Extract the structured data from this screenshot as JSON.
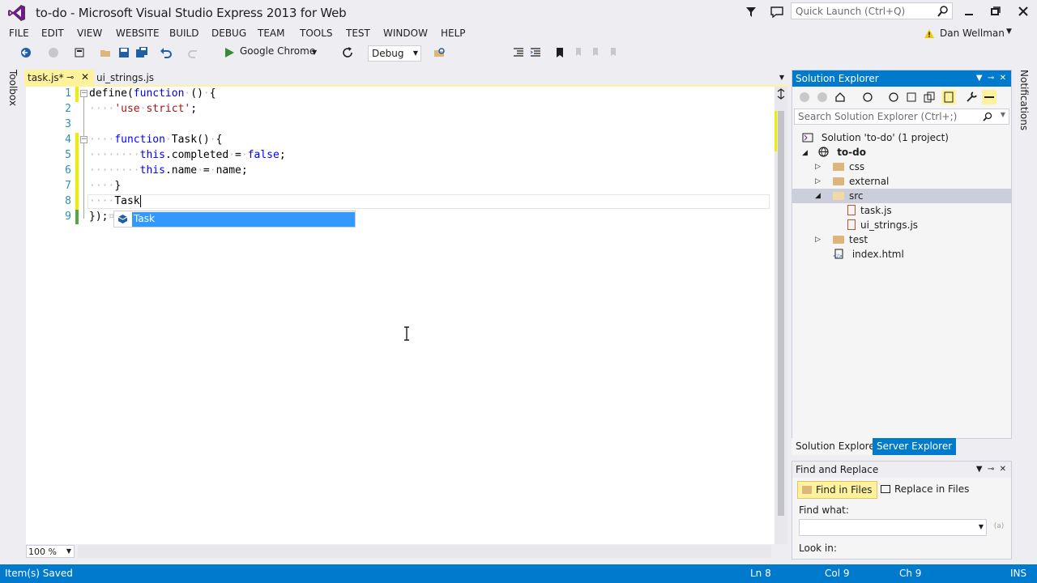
{
  "window": {
    "title": "to-do - Microsoft Visual Studio Express 2013 for Web",
    "quick_launch_placeholder": "Quick Launch (Ctrl+Q)",
    "user_name": "Dan Wellman"
  },
  "menu": [
    "FILE",
    "EDIT",
    "VIEW",
    "WEBSITE",
    "BUILD",
    "DEBUG",
    "TEAM",
    "TOOLS",
    "TEST",
    "WINDOW",
    "HELP"
  ],
  "toolbar": {
    "launch_target": "Google Chrome",
    "configuration": "Debug"
  },
  "side_strips": {
    "left": "Toolbox",
    "right": "Notifications"
  },
  "tabs": [
    {
      "label": "task.js*",
      "active": true
    },
    {
      "label": "ui_strings.js",
      "active": false
    }
  ],
  "editor": {
    "line_numbers": [
      "1",
      "2",
      "3",
      "4",
      "5",
      "6",
      "7",
      "8",
      "9"
    ],
    "completion_item": "Task",
    "zoom": "100 %"
  },
  "solution_explorer": {
    "title": "Solution Explorer",
    "search_placeholder": "Search Solution Explorer (Ctrl+;)",
    "tree": [
      {
        "label": "Solution 'to-do' (1 project)",
        "kind": "solution"
      },
      {
        "label": "to-do",
        "kind": "project"
      },
      {
        "label": "css",
        "kind": "folder"
      },
      {
        "label": "external",
        "kind": "folder"
      },
      {
        "label": "src",
        "kind": "folder",
        "selected": true
      },
      {
        "label": "task.js",
        "kind": "js-file"
      },
      {
        "label": "ui_strings.js",
        "kind": "js-file"
      },
      {
        "label": "test",
        "kind": "folder"
      },
      {
        "label": "index.html",
        "kind": "html-file"
      }
    ],
    "bottom_tabs": [
      "Solution Explorer",
      "Server Explorer"
    ]
  },
  "find_replace": {
    "title": "Find and Replace",
    "find_in_files": "Find in Files",
    "replace_in_files": "Replace in Files",
    "find_what_label": "Find what:",
    "look_in_label": "Look in:"
  },
  "status": {
    "message": "Item(s) Saved",
    "line": "Ln 8",
    "col": "Col 9",
    "ch": "Ch 9",
    "mode": "INS"
  },
  "colors": {
    "accent": "#007ACC",
    "tab_active": "#FFF29D",
    "selection": "#3399FF"
  }
}
